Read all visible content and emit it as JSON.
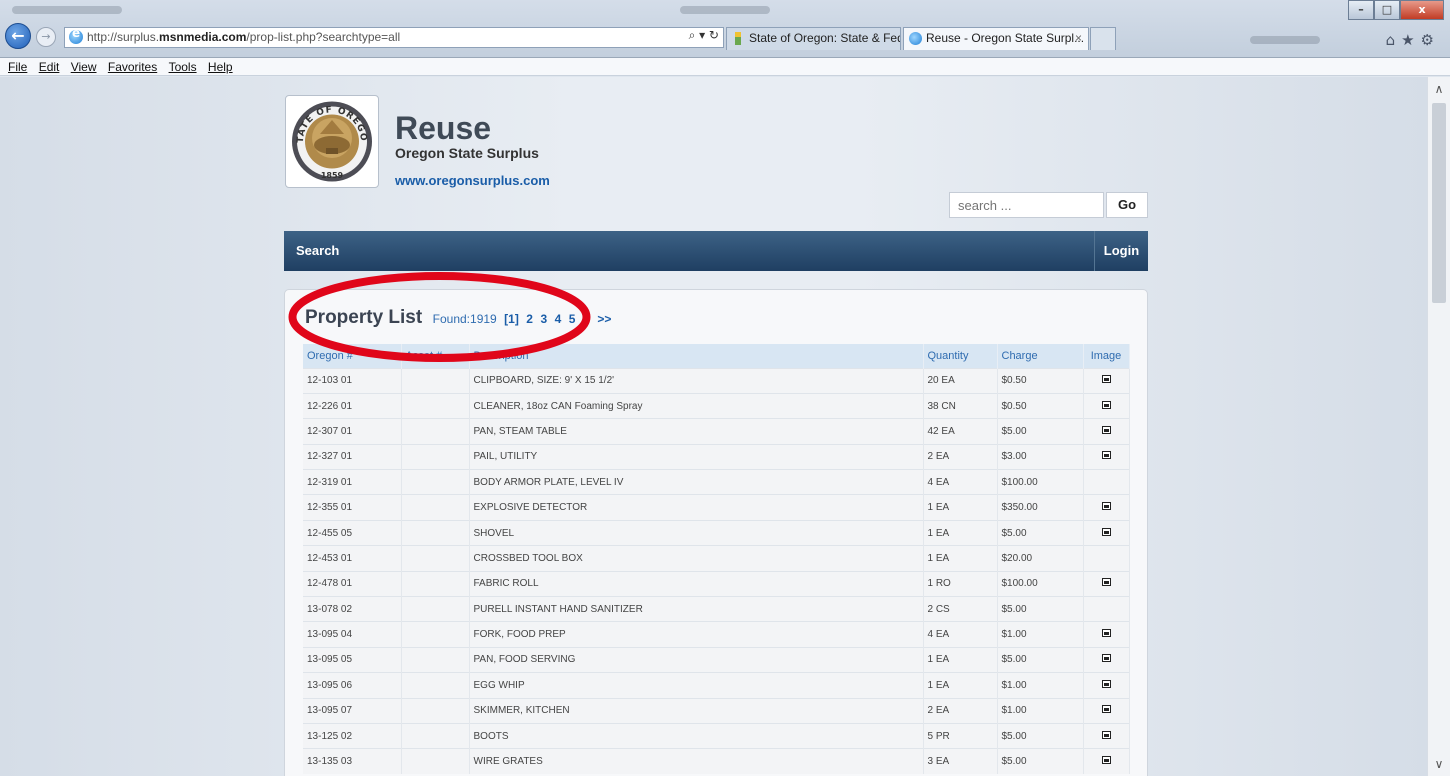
{
  "browser": {
    "url_prefix": "http://surplus.",
    "url_domain": "msnmedia.com",
    "url_path": "/prop-list.php?searchtype=all",
    "addr_tools": "⌕ ▾ ↻",
    "tabs": [
      {
        "label": "State of Oregon: State & Feder..."
      },
      {
        "label": "Reuse - Oregon State Surpl..."
      }
    ],
    "tab_close": "×",
    "window_buttons": {
      "minimize": "–",
      "maximize": "□",
      "close": "x"
    },
    "toolbar_icons": "⌂★⚙",
    "menu": [
      "File",
      "Edit",
      "View",
      "Favorites",
      "Tools",
      "Help"
    ]
  },
  "site": {
    "title": "Reuse",
    "subtitle": "Oregon State Surplus",
    "link": "www.oregonsurplus.com",
    "seal_text_top": "STATE OF OREGON",
    "seal_year": "1859"
  },
  "search": {
    "placeholder": "search ...",
    "go_label": "Go"
  },
  "nav": {
    "search_label": "Search",
    "login_label": "Login"
  },
  "list": {
    "title": "Property List",
    "found_label": "Found:",
    "found_count": "1919",
    "current_page": "[1]",
    "pages": [
      "2",
      "3",
      "4",
      "5",
      ">",
      ">>"
    ],
    "columns": [
      "Oregon #",
      "Asset #",
      "Description",
      "Quantity",
      "Charge",
      "Image"
    ],
    "rows": [
      {
        "oregon": "12-103 01",
        "asset": "",
        "description": "CLIPBOARD, SIZE: 9' X 15 1/2'",
        "quantity": "20 EA",
        "charge": "$0.50",
        "image": true
      },
      {
        "oregon": "12-226 01",
        "asset": "",
        "description": "CLEANER, 18oz CAN Foaming Spray",
        "quantity": "38 CN",
        "charge": "$0.50",
        "image": true
      },
      {
        "oregon": "12-307 01",
        "asset": "",
        "description": "PAN, STEAM TABLE",
        "quantity": "42 EA",
        "charge": "$5.00",
        "image": true
      },
      {
        "oregon": "12-327 01",
        "asset": "",
        "description": "PAIL, UTILITY",
        "quantity": "2 EA",
        "charge": "$3.00",
        "image": true
      },
      {
        "oregon": "12-319 01",
        "asset": "",
        "description": "BODY ARMOR PLATE, LEVEL IV",
        "quantity": "4 EA",
        "charge": "$100.00",
        "image": false
      },
      {
        "oregon": "12-355 01",
        "asset": "",
        "description": "EXPLOSIVE DETECTOR",
        "quantity": "1 EA",
        "charge": "$350.00",
        "image": true
      },
      {
        "oregon": "12-455 05",
        "asset": "",
        "description": "SHOVEL",
        "quantity": "1 EA",
        "charge": "$5.00",
        "image": true
      },
      {
        "oregon": "12-453 01",
        "asset": "",
        "description": "CROSSBED TOOL BOX",
        "quantity": "1 EA",
        "charge": "$20.00",
        "image": false
      },
      {
        "oregon": "12-478 01",
        "asset": "",
        "description": "FABRIC ROLL",
        "quantity": "1 RO",
        "charge": "$100.00",
        "image": true
      },
      {
        "oregon": "13-078 02",
        "asset": "",
        "description": "PURELL INSTANT HAND SANITIZER",
        "quantity": "2 CS",
        "charge": "$5.00",
        "image": false
      },
      {
        "oregon": "13-095 04",
        "asset": "",
        "description": "FORK, FOOD PREP",
        "quantity": "4 EA",
        "charge": "$1.00",
        "image": true
      },
      {
        "oregon": "13-095 05",
        "asset": "",
        "description": "PAN, FOOD SERVING",
        "quantity": "1 EA",
        "charge": "$5.00",
        "image": true
      },
      {
        "oregon": "13-095 06",
        "asset": "",
        "description": "EGG WHIP",
        "quantity": "1 EA",
        "charge": "$1.00",
        "image": true
      },
      {
        "oregon": "13-095 07",
        "asset": "",
        "description": "SKIMMER, KITCHEN",
        "quantity": "2 EA",
        "charge": "$1.00",
        "image": true
      },
      {
        "oregon": "13-125 02",
        "asset": "",
        "description": "BOOTS",
        "quantity": "5 PR",
        "charge": "$5.00",
        "image": true
      },
      {
        "oregon": "13-135 03",
        "asset": "",
        "description": "WIRE GRATES",
        "quantity": "3 EA",
        "charge": "$5.00",
        "image": true
      }
    ]
  },
  "colors": {
    "annotation": "#e0061a",
    "nav_bar": "#2b4c70",
    "link": "#1a5da8"
  }
}
